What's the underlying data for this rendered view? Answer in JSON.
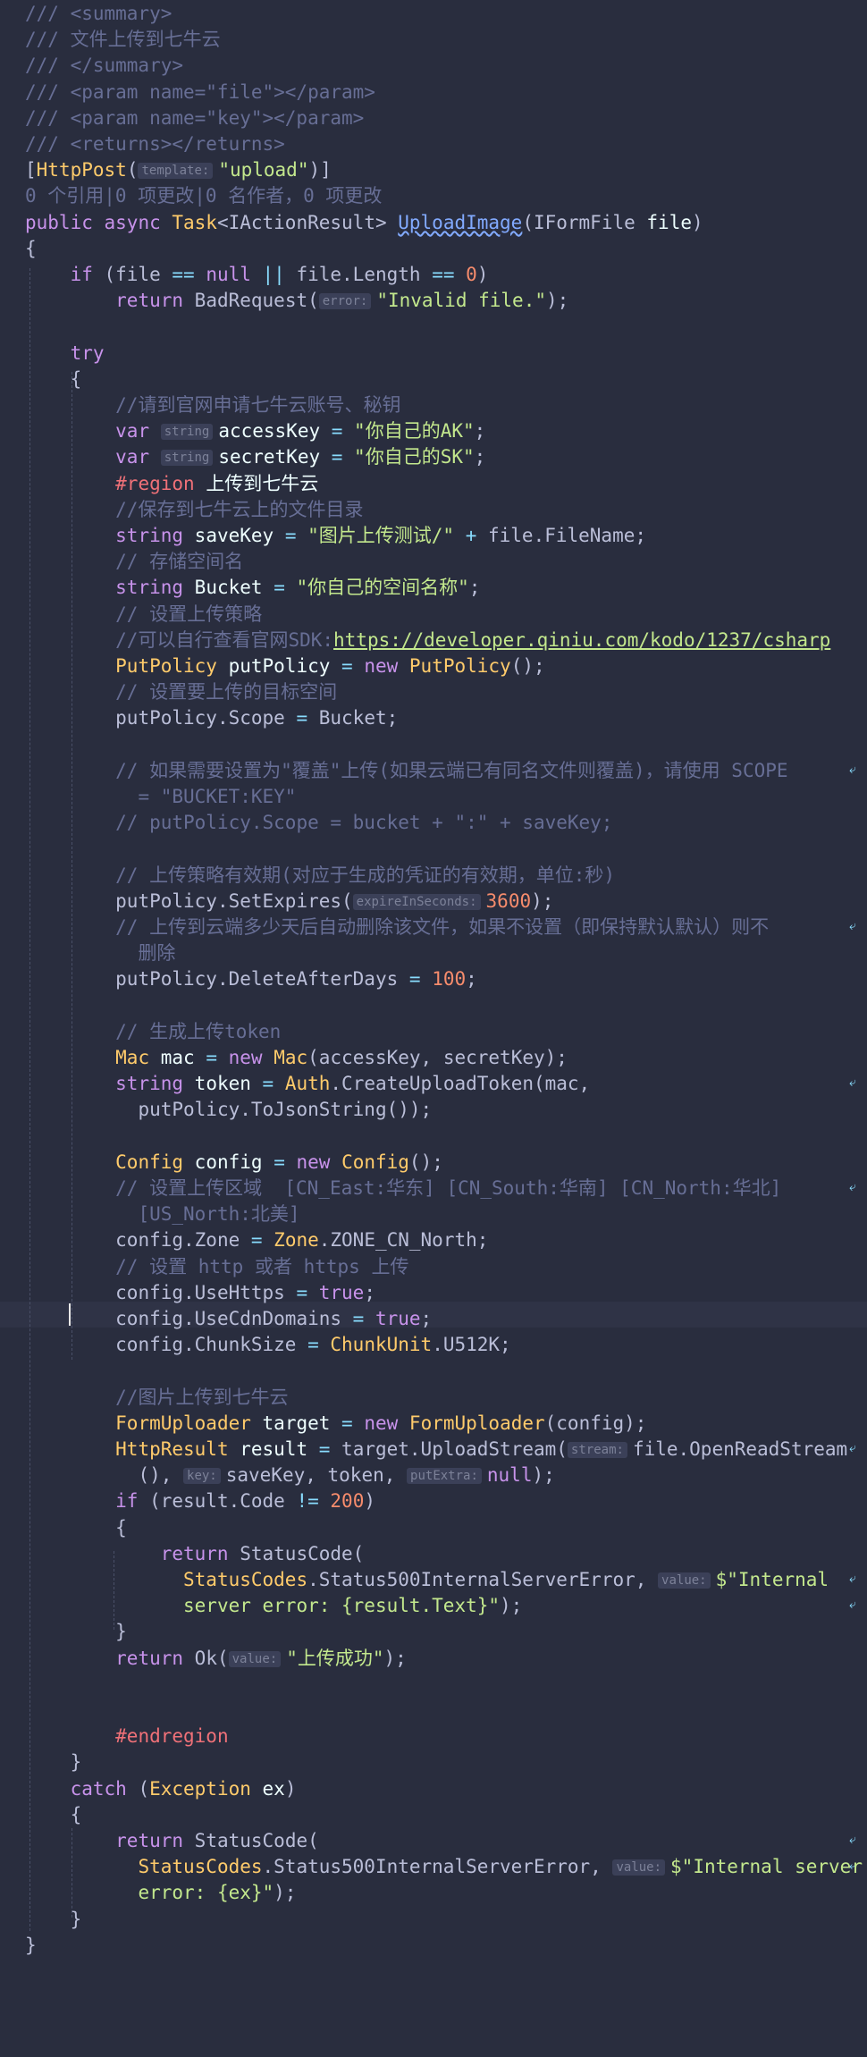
{
  "editor": {
    "codelens": "0 个引用|0 项更改|0 名作者，0 项更改",
    "lines": [
      [
        [
          "t-comment",
          "/// <summary>"
        ]
      ],
      [
        [
          "t-comment",
          "/// 文件上传到七牛云"
        ]
      ],
      [
        [
          "t-comment",
          "/// </summary>"
        ]
      ],
      [
        [
          "t-comment",
          "/// <param name=\"file\"></param>"
        ]
      ],
      [
        [
          "t-comment",
          "/// <param name=\"key\"></param>"
        ]
      ],
      [
        [
          "t-comment",
          "/// <returns></returns>"
        ]
      ],
      [
        [
          "",
          "["
        ],
        [
          "t-type",
          "HttpPost"
        ],
        [
          "",
          "("
        ],
        [
          "t-hint",
          "template:"
        ],
        [
          "t-string",
          "\"upload\""
        ],
        [
          "",
          ")]"
        ]
      ],
      [
        [
          "t-comment",
          "0 个引用|0 项更改|0 名作者，0 项更改"
        ]
      ],
      [
        [
          "t-keyword",
          "public "
        ],
        [
          "t-keyword",
          "async "
        ],
        [
          "t-type",
          "Task"
        ],
        [
          "",
          "<IActionResult> "
        ],
        [
          "t-method t-squiggle",
          "UploadImage"
        ],
        [
          "",
          "(IFormFile "
        ],
        [
          "t-variable",
          "file"
        ],
        [
          "",
          ")"
        ]
      ],
      [
        [
          "",
          "{"
        ]
      ],
      [
        [
          "",
          "    "
        ],
        [
          "t-keyword",
          "if "
        ],
        [
          "",
          "(file "
        ],
        [
          "t-operator",
          "== "
        ],
        [
          "t-keyword",
          "null "
        ],
        [
          "t-operator",
          "|| "
        ],
        [
          "",
          "file.Length "
        ],
        [
          "t-operator",
          "== "
        ],
        [
          "t-number",
          "0"
        ],
        [
          "",
          ")"
        ]
      ],
      [
        [
          "",
          "        "
        ],
        [
          "t-keyword",
          "return "
        ],
        [
          "",
          "BadRequest("
        ],
        [
          "t-hint",
          "error:"
        ],
        [
          "t-string",
          "\"Invalid file.\""
        ],
        [
          "",
          ");"
        ]
      ],
      [
        [
          "",
          ""
        ]
      ],
      [
        [
          "",
          "    "
        ],
        [
          "t-keyword",
          "try"
        ]
      ],
      [
        [
          "",
          "    {"
        ]
      ],
      [
        [
          "",
          "        "
        ],
        [
          "t-comment",
          "//请到官网申请七牛云账号、秘钥"
        ]
      ],
      [
        [
          "",
          "        "
        ],
        [
          "t-keyword",
          "var "
        ],
        [
          "t-hint",
          "string"
        ],
        [
          "t-variable",
          "accessKey "
        ],
        [
          "t-operator",
          "= "
        ],
        [
          "t-string",
          "\"你自己的AK\""
        ],
        [
          "",
          ";"
        ]
      ],
      [
        [
          "",
          "        "
        ],
        [
          "t-keyword",
          "var "
        ],
        [
          "t-hint",
          "string"
        ],
        [
          "t-variable",
          "secretKey "
        ],
        [
          "t-operator",
          "= "
        ],
        [
          "t-string",
          "\"你自己的SK\""
        ],
        [
          "",
          ";"
        ]
      ],
      [
        [
          "",
          "        "
        ],
        [
          "t-region",
          "#region "
        ],
        [
          "t-variable",
          "上传到七牛云"
        ]
      ],
      [
        [
          "",
          "        "
        ],
        [
          "t-comment",
          "//保存到七牛云上的文件目录"
        ]
      ],
      [
        [
          "",
          "        "
        ],
        [
          "t-keyword",
          "string "
        ],
        [
          "t-variable",
          "saveKey "
        ],
        [
          "t-operator",
          "= "
        ],
        [
          "t-string",
          "\"图片上传测试/\" "
        ],
        [
          "t-operator",
          "+ "
        ],
        [
          "",
          "file.FileName;"
        ]
      ],
      [
        [
          "",
          "        "
        ],
        [
          "t-comment",
          "// 存储空间名"
        ]
      ],
      [
        [
          "",
          "        "
        ],
        [
          "t-keyword",
          "string "
        ],
        [
          "t-variable",
          "Bucket "
        ],
        [
          "t-operator",
          "= "
        ],
        [
          "t-string",
          "\"你自己的空间名称\""
        ],
        [
          "",
          ";"
        ]
      ],
      [
        [
          "",
          "        "
        ],
        [
          "t-comment",
          "// 设置上传策略"
        ]
      ],
      [
        [
          "",
          "        "
        ],
        [
          "t-comment",
          "//可以自行查看官网SDK:"
        ],
        [
          "t-link",
          "https://developer.qiniu.com/kodo/1237/csharp"
        ]
      ],
      [
        [
          "",
          "        "
        ],
        [
          "t-type",
          "PutPolicy "
        ],
        [
          "t-variable",
          "putPolicy "
        ],
        [
          "t-operator",
          "= "
        ],
        [
          "t-keyword",
          "new "
        ],
        [
          "t-type",
          "PutPolicy"
        ],
        [
          "",
          "();"
        ]
      ],
      [
        [
          "",
          "        "
        ],
        [
          "t-comment",
          "// 设置要上传的目标空间"
        ]
      ],
      [
        [
          "",
          "        "
        ],
        [
          "",
          "putPolicy.Scope "
        ],
        [
          "t-operator",
          "= "
        ],
        [
          "",
          "Bucket;"
        ]
      ],
      [
        [
          "",
          ""
        ]
      ],
      [
        [
          "",
          "        "
        ],
        [
          "t-comment",
          "// 如果需要设置为\"覆盖\"上传(如果云端已有同名文件则覆盖)，请使用 SCOPE"
        ]
      ],
      [
        [
          "",
          "          "
        ],
        [
          "t-comment",
          "= \"BUCKET:KEY\""
        ]
      ],
      [
        [
          "",
          "        "
        ],
        [
          "t-comment",
          "// putPolicy.Scope = bucket + \":\" + saveKey;"
        ]
      ],
      [
        [
          "",
          ""
        ]
      ],
      [
        [
          "",
          "        "
        ],
        [
          "t-comment",
          "// 上传策略有效期(对应于生成的凭证的有效期，单位:秒)"
        ]
      ],
      [
        [
          "",
          "        "
        ],
        [
          "",
          "putPolicy.SetExpires("
        ],
        [
          "t-hint",
          "expireInSeconds:"
        ],
        [
          "t-number",
          "3600"
        ],
        [
          "",
          ");"
        ]
      ],
      [
        [
          "",
          "        "
        ],
        [
          "t-comment",
          "// 上传到云端多少天后自动删除该文件，如果不设置（即保持默认默认）则不"
        ]
      ],
      [
        [
          "",
          "          "
        ],
        [
          "t-comment",
          "删除"
        ]
      ],
      [
        [
          "",
          "        "
        ],
        [
          "",
          "putPolicy.DeleteAfterDays "
        ],
        [
          "t-operator",
          "= "
        ],
        [
          "t-number",
          "100"
        ],
        [
          "",
          ";"
        ]
      ],
      [
        [
          "",
          ""
        ]
      ],
      [
        [
          "",
          "        "
        ],
        [
          "t-comment",
          "// 生成上传token"
        ]
      ],
      [
        [
          "",
          "        "
        ],
        [
          "t-type",
          "Mac "
        ],
        [
          "t-variable",
          "mac "
        ],
        [
          "t-operator",
          "= "
        ],
        [
          "t-keyword",
          "new "
        ],
        [
          "t-type",
          "Mac"
        ],
        [
          "",
          "(accessKey, secretKey);"
        ]
      ],
      [
        [
          "",
          "        "
        ],
        [
          "t-keyword",
          "string "
        ],
        [
          "t-variable",
          "token "
        ],
        [
          "t-operator",
          "= "
        ],
        [
          "t-type",
          "Auth"
        ],
        [
          "",
          ".CreateUploadToken(mac,"
        ]
      ],
      [
        [
          "",
          "          "
        ],
        [
          "",
          "putPolicy.ToJsonString());"
        ]
      ],
      [
        [
          "",
          ""
        ]
      ],
      [
        [
          "",
          "        "
        ],
        [
          "t-type",
          "Config "
        ],
        [
          "t-variable",
          "config "
        ],
        [
          "t-operator",
          "= "
        ],
        [
          "t-keyword",
          "new "
        ],
        [
          "t-type",
          "Config"
        ],
        [
          "",
          "();"
        ]
      ],
      [
        [
          "",
          "        "
        ],
        [
          "t-comment",
          "// 设置上传区域  [CN_East:华东] [CN_South:华南] [CN_North:华北]"
        ]
      ],
      [
        [
          "",
          "          "
        ],
        [
          "t-comment",
          "[US_North:北美]"
        ]
      ],
      [
        [
          "",
          "        "
        ],
        [
          "",
          "config.Zone "
        ],
        [
          "t-operator",
          "= "
        ],
        [
          "t-type",
          "Zone"
        ],
        [
          "",
          ".ZONE_CN_North;"
        ]
      ],
      [
        [
          "",
          "        "
        ],
        [
          "t-comment",
          "// 设置 http 或者 https 上传"
        ]
      ],
      [
        [
          "",
          "        "
        ],
        [
          "",
          "config.UseHttps "
        ],
        [
          "t-operator",
          "= "
        ],
        [
          "t-keyword",
          "true"
        ],
        [
          "",
          ";"
        ]
      ],
      [
        [
          "",
          "        "
        ],
        [
          "",
          "config.UseCdnDomains "
        ],
        [
          "t-operator",
          "= "
        ],
        [
          "t-keyword",
          "true"
        ],
        [
          "",
          ";"
        ]
      ],
      [
        [
          "",
          "        "
        ],
        [
          "",
          "config.ChunkSize "
        ],
        [
          "t-operator",
          "= "
        ],
        [
          "t-type",
          "ChunkUnit"
        ],
        [
          "",
          ".U512K;"
        ]
      ],
      [
        [
          "",
          ""
        ]
      ],
      [
        [
          "",
          "        "
        ],
        [
          "t-comment",
          "//图片上传到七牛云"
        ]
      ],
      [
        [
          "",
          "        "
        ],
        [
          "t-type",
          "FormUploader "
        ],
        [
          "t-variable",
          "target "
        ],
        [
          "t-operator",
          "= "
        ],
        [
          "t-keyword",
          "new "
        ],
        [
          "t-type",
          "FormUploader"
        ],
        [
          "",
          "(config);"
        ]
      ],
      [
        [
          "",
          "        "
        ],
        [
          "t-type",
          "HttpResult "
        ],
        [
          "t-variable",
          "result "
        ],
        [
          "t-operator",
          "= "
        ],
        [
          "",
          "target.UploadStream("
        ],
        [
          "t-hint",
          "stream:"
        ],
        [
          "",
          "file.OpenReadStream"
        ]
      ],
      [
        [
          "",
          "          "
        ],
        [
          "",
          "(), "
        ],
        [
          "t-hint",
          "key:"
        ],
        [
          "",
          "saveKey, token, "
        ],
        [
          "t-hint",
          "putExtra:"
        ],
        [
          "t-keyword",
          "null"
        ],
        [
          "",
          ");"
        ]
      ],
      [
        [
          "",
          "        "
        ],
        [
          "t-keyword",
          "if "
        ],
        [
          "",
          "(result.Code "
        ],
        [
          "t-operator",
          "!= "
        ],
        [
          "t-number",
          "200"
        ],
        [
          "",
          ")"
        ]
      ],
      [
        [
          "",
          "        {"
        ]
      ],
      [
        [
          "",
          "            "
        ],
        [
          "t-keyword",
          "return "
        ],
        [
          "",
          "StatusCode("
        ]
      ],
      [
        [
          "",
          "              "
        ],
        [
          "t-type",
          "StatusCodes"
        ],
        [
          "",
          ".Status500InternalServerError, "
        ],
        [
          "t-hint",
          "value:"
        ],
        [
          "t-string",
          "$\"Internal"
        ]
      ],
      [
        [
          "",
          "              "
        ],
        [
          "t-string",
          "server error: {result.Text}\""
        ],
        [
          "",
          ");"
        ]
      ],
      [
        [
          "",
          "        }"
        ]
      ],
      [
        [
          "",
          "        "
        ],
        [
          "t-keyword",
          "return "
        ],
        [
          "",
          "Ok("
        ],
        [
          "t-hint",
          "value:"
        ],
        [
          "t-string",
          "\"上传成功\""
        ],
        [
          "",
          ");"
        ]
      ],
      [
        [
          "",
          ""
        ]
      ],
      [
        [
          "",
          ""
        ]
      ],
      [
        [
          "",
          "        "
        ],
        [
          "t-region",
          "#endregion"
        ]
      ],
      [
        [
          "",
          "    }"
        ]
      ],
      [
        [
          "",
          "    "
        ],
        [
          "t-keyword",
          "catch "
        ],
        [
          "",
          "("
        ],
        [
          "t-type",
          "Exception "
        ],
        [
          "t-variable",
          "ex"
        ],
        [
          "",
          ")"
        ]
      ],
      [
        [
          "",
          "    {"
        ]
      ],
      [
        [
          "",
          "        "
        ],
        [
          "t-keyword",
          "return "
        ],
        [
          "",
          "StatusCode("
        ]
      ],
      [
        [
          "",
          "          "
        ],
        [
          "t-type",
          "StatusCodes"
        ],
        [
          "",
          ".Status500InternalServerError, "
        ],
        [
          "t-hint",
          "value:"
        ],
        [
          "t-string",
          "$\"Internal server"
        ]
      ],
      [
        [
          "",
          "          "
        ],
        [
          "t-string",
          "error: {ex}\""
        ],
        [
          "",
          ");"
        ]
      ],
      [
        [
          "",
          "    }"
        ]
      ],
      [
        [
          "",
          "}"
        ]
      ]
    ]
  }
}
